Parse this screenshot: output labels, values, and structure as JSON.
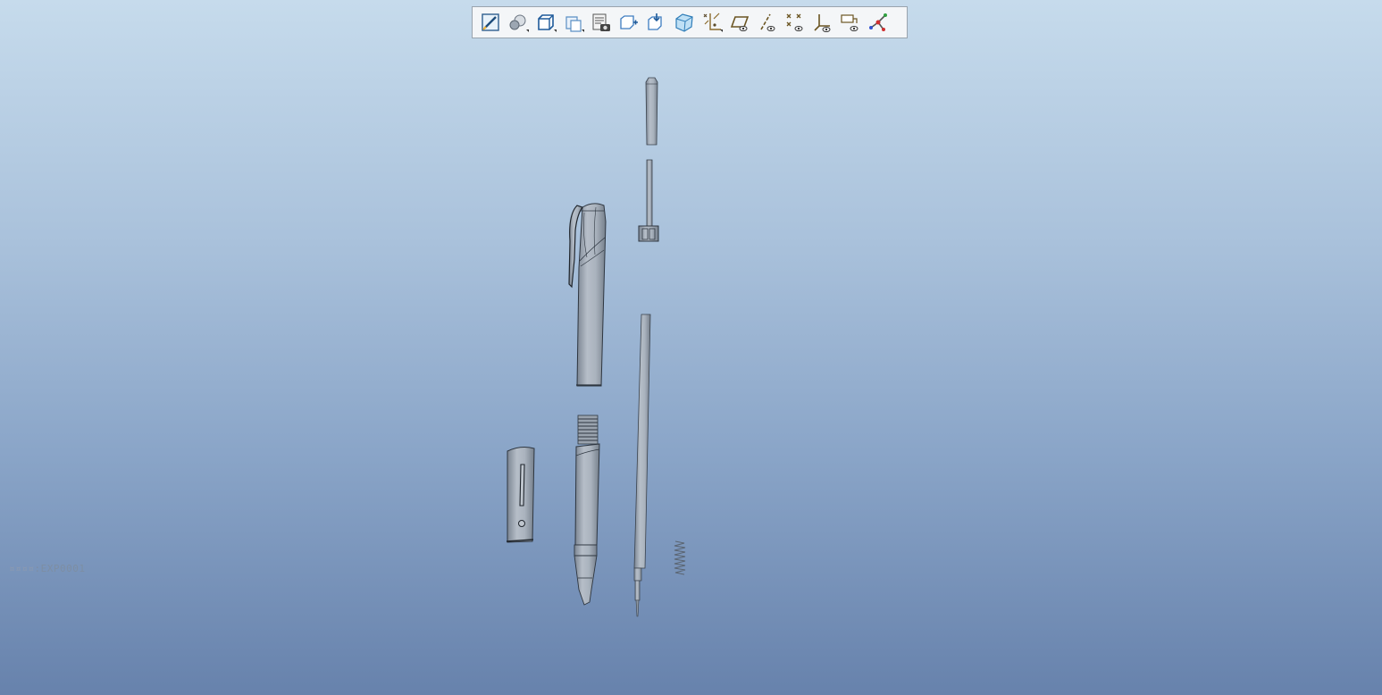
{
  "toolbar": {
    "buttons": [
      {
        "name": "sketch-tool",
        "icon": "sketch-icon",
        "dropdown": false
      },
      {
        "name": "appearance-tool",
        "icon": "appearance-sphere-icon",
        "dropdown": true
      },
      {
        "name": "display-style-tool",
        "icon": "shaded-cube-icon",
        "dropdown": true
      },
      {
        "name": "saved-views-tool",
        "icon": "saved-views-icon",
        "dropdown": true
      },
      {
        "name": "view-manager-tool",
        "icon": "view-manager-icon",
        "dropdown": false
      },
      {
        "name": "zoom-in-tool",
        "icon": "zoom-in-icon",
        "dropdown": false
      },
      {
        "name": "repaint-tool",
        "icon": "repaint-icon",
        "dropdown": false
      },
      {
        "name": "perspective-tool",
        "icon": "perspective-cube-icon",
        "dropdown": false
      },
      {
        "name": "datum-display-tool",
        "icon": "datum-display-icon",
        "dropdown": true
      },
      {
        "name": "plane-display-tool",
        "icon": "plane-display-icon",
        "dropdown": false
      },
      {
        "name": "axis-display-tool",
        "icon": "axis-display-icon",
        "dropdown": false
      },
      {
        "name": "point-display-tool",
        "icon": "point-display-icon",
        "dropdown": false
      },
      {
        "name": "csys-display-tool",
        "icon": "csys-display-icon",
        "dropdown": false
      },
      {
        "name": "annotation-display-tool",
        "icon": "annotation-display-icon",
        "dropdown": false
      },
      {
        "name": "spin-center-tool",
        "icon": "spin-center-icon",
        "dropdown": false
      }
    ]
  },
  "status": {
    "prefix": "¤¤¤¤",
    "explode_state": ":EXP0001"
  },
  "colors": {
    "part": "#a4adb7",
    "part_edge": "#2e3640",
    "toolbar_bg": "#f4f6f8"
  }
}
